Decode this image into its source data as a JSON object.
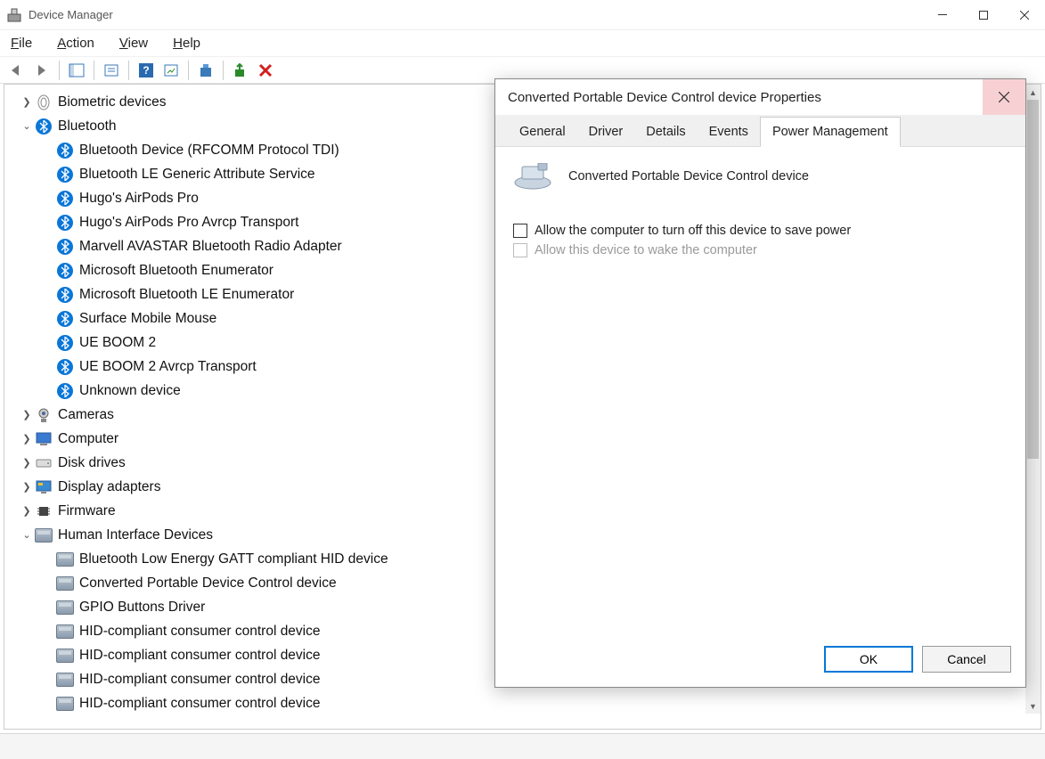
{
  "window": {
    "title": "Device Manager"
  },
  "menu": {
    "file": "File",
    "action": "Action",
    "view": "View",
    "help": "Help"
  },
  "tree": {
    "biometric": "Biometric devices",
    "bluetooth": "Bluetooth",
    "bt_children": [
      "Bluetooth Device (RFCOMM Protocol TDI)",
      "Bluetooth LE Generic Attribute Service",
      "Hugo's AirPods Pro",
      "Hugo's AirPods Pro Avrcp Transport",
      "Marvell AVASTAR Bluetooth Radio Adapter",
      "Microsoft Bluetooth Enumerator",
      "Microsoft Bluetooth LE Enumerator",
      "Surface Mobile Mouse",
      "UE BOOM 2",
      "UE BOOM 2 Avrcp Transport",
      "Unknown device"
    ],
    "cameras": "Cameras",
    "computer": "Computer",
    "disk": "Disk drives",
    "display": "Display adapters",
    "firmware": "Firmware",
    "hid": "Human Interface Devices",
    "hid_children": [
      "Bluetooth Low Energy GATT compliant HID device",
      "Converted Portable Device Control device",
      "GPIO Buttons Driver",
      "HID-compliant consumer control device",
      "HID-compliant consumer control device",
      "HID-compliant consumer control device",
      "HID-compliant consumer control device"
    ]
  },
  "dialog": {
    "title": "Converted Portable Device Control device Properties",
    "tabs": {
      "general": "General",
      "driver": "Driver",
      "details": "Details",
      "events": "Events",
      "power": "Power Management"
    },
    "device_name": "Converted Portable Device Control device",
    "allow_off": "Allow the computer to turn off this device to save power",
    "allow_wake": "Allow this device to wake the computer",
    "ok": "OK",
    "cancel": "Cancel"
  }
}
